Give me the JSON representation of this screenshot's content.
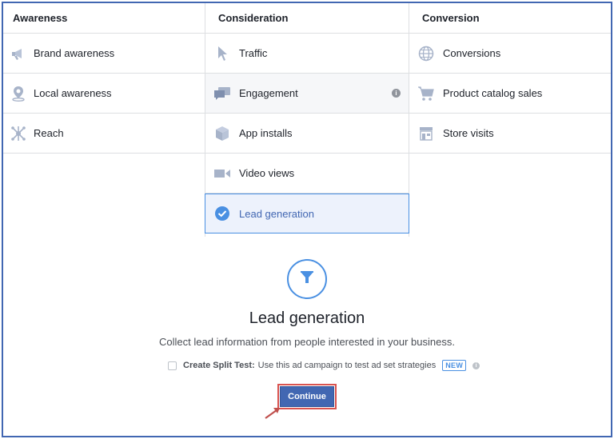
{
  "columns": [
    {
      "header": "Awareness",
      "items": [
        {
          "label": "Brand awareness",
          "icon": "megaphone-icon"
        },
        {
          "label": "Local awareness",
          "icon": "map-pin-icon"
        },
        {
          "label": "Reach",
          "icon": "reach-icon"
        }
      ]
    },
    {
      "header": "Consideration",
      "items": [
        {
          "label": "Traffic",
          "icon": "cursor-icon"
        },
        {
          "label": "Engagement",
          "icon": "chat-bubbles-icon",
          "state": "hover"
        },
        {
          "label": "App installs",
          "icon": "box-icon"
        },
        {
          "label": "Video views",
          "icon": "video-camera-icon"
        },
        {
          "label": "Lead generation",
          "icon": "checkmark-circle-icon",
          "state": "selected"
        }
      ]
    },
    {
      "header": "Conversion",
      "items": [
        {
          "label": "Conversions",
          "icon": "globe-icon"
        },
        {
          "label": "Product catalog sales",
          "icon": "shopping-cart-icon"
        },
        {
          "label": "Store visits",
          "icon": "store-icon"
        }
      ]
    }
  ],
  "detail": {
    "icon": "funnel-icon",
    "title": "Lead generation",
    "description": "Collect lead information from people interested in your business.",
    "split_test_label": "Create Split Test:",
    "split_test_text": "Use this ad campaign to test ad set strategies",
    "split_test_checked": false,
    "new_badge": "NEW",
    "continue_label": "Continue"
  },
  "colors": {
    "accent": "#4267b2",
    "selected_border": "#4a90e2",
    "selected_bg": "#edf2fc",
    "highlight_red": "#d9534f",
    "icon_gray": "#a7b3c9"
  }
}
